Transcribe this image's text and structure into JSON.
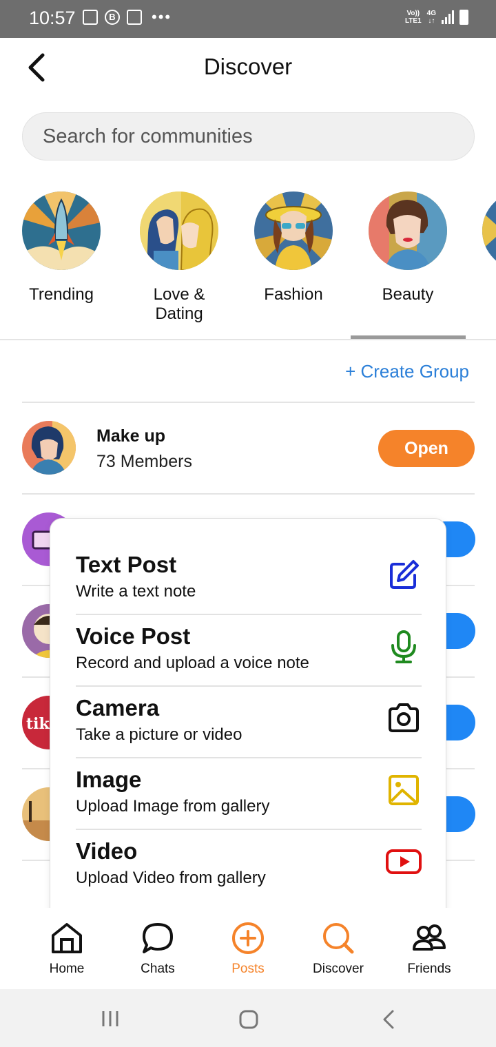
{
  "status_bar": {
    "time": "10:57",
    "network_top": "Vo))",
    "network_bottom": "LTE1",
    "network_type": "4G"
  },
  "header": {
    "title": "Discover",
    "back_icon": "chevron-left-icon"
  },
  "search": {
    "placeholder": "Search for communities"
  },
  "categories": [
    {
      "label": "Trending"
    },
    {
      "label": "Love & Dating"
    },
    {
      "label": "Fashion"
    },
    {
      "label": "Beauty"
    }
  ],
  "create_group": "+ Create Group",
  "group": {
    "name": "Make up",
    "members": "73 Members",
    "action": "Open"
  },
  "post_menu": [
    {
      "title": "Text Post",
      "subtitle": "Write a text note",
      "icon": "edit-icon",
      "color": "#1a2ed8"
    },
    {
      "title": "Voice Post",
      "subtitle": "Record and upload a voice note",
      "icon": "microphone-icon",
      "color": "#1f8a1f"
    },
    {
      "title": "Camera",
      "subtitle": "Take a picture or video",
      "icon": "camera-icon",
      "color": "#111111"
    },
    {
      "title": "Image",
      "subtitle": "Upload Image from gallery",
      "icon": "image-icon",
      "color": "#e0b400"
    },
    {
      "title": "Video",
      "subtitle": "Upload Video from gallery",
      "icon": "youtube-icon",
      "color": "#e01010"
    }
  ],
  "bottom_nav": [
    {
      "label": "Home",
      "icon": "home-icon"
    },
    {
      "label": "Chats",
      "icon": "chat-icon"
    },
    {
      "label": "Posts",
      "icon": "plus-circle-icon",
      "active": true
    },
    {
      "label": "Discover",
      "icon": "search-icon"
    },
    {
      "label": "Friends",
      "icon": "friends-icon"
    }
  ],
  "colors": {
    "accent": "#f5832a",
    "link": "#2b7fd8",
    "button_blue": "#1f87f5"
  }
}
